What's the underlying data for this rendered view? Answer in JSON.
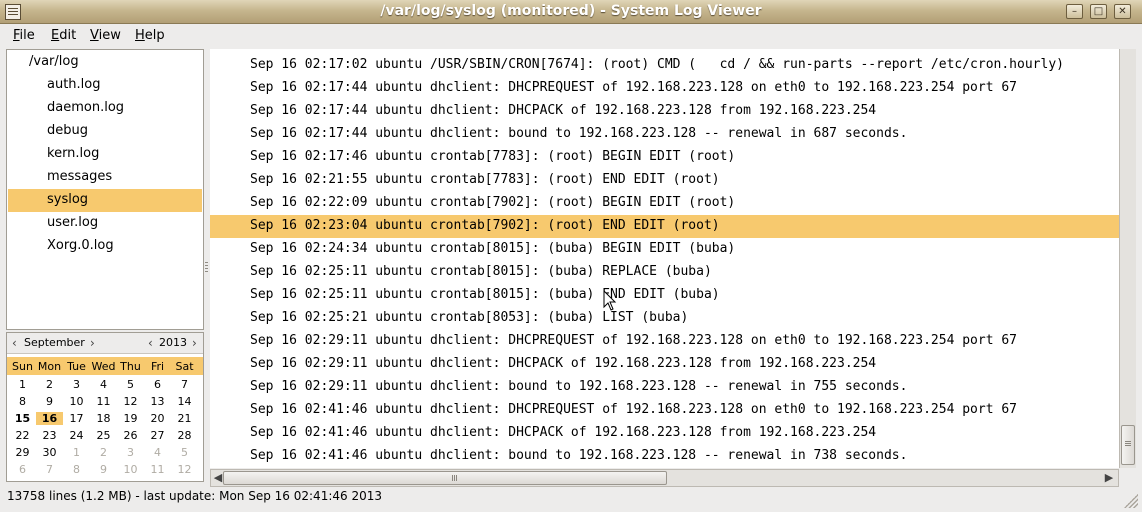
{
  "window": {
    "title": "/var/log/syslog (monitored) - System Log Viewer",
    "buttons": {
      "minimize": "–",
      "maximize": "□",
      "close": "✕"
    }
  },
  "menu": [
    {
      "label": "File",
      "mnemonic": "F",
      "rest": "ile"
    },
    {
      "label": "Edit",
      "mnemonic": "E",
      "rest": "dit"
    },
    {
      "label": "View",
      "mnemonic": "V",
      "rest": "iew"
    },
    {
      "label": "Help",
      "mnemonic": "H",
      "rest": "elp"
    }
  ],
  "sidebar": {
    "root": "/var/log",
    "items": [
      {
        "label": "auth.log"
      },
      {
        "label": "daemon.log"
      },
      {
        "label": "debug"
      },
      {
        "label": "kern.log"
      },
      {
        "label": "messages"
      },
      {
        "label": "syslog",
        "selected": true
      },
      {
        "label": "user.log"
      },
      {
        "label": "Xorg.0.log"
      }
    ]
  },
  "calendar": {
    "month": "September",
    "year": "2013",
    "day_names": [
      "Sun",
      "Mon",
      "Tue",
      "Wed",
      "Thu",
      "Fri",
      "Sat"
    ],
    "weeks": [
      [
        "1",
        "2",
        "3",
        "4",
        "5",
        "6",
        "7"
      ],
      [
        "8",
        "9",
        "10",
        "11",
        "12",
        "13",
        "14"
      ],
      [
        "15",
        "16",
        "17",
        "18",
        "19",
        "20",
        "21"
      ],
      [
        "22",
        "23",
        "24",
        "25",
        "26",
        "27",
        "28"
      ],
      [
        "29",
        "30",
        "1",
        "2",
        "3",
        "4",
        "5"
      ],
      [
        "6",
        "7",
        "8",
        "9",
        "10",
        "11",
        "12"
      ]
    ],
    "bold_day": "15",
    "selected_day": "16",
    "muted_from_index": 30
  },
  "log": {
    "lines": [
      "Sep 16 02:17:02 ubuntu /USR/SBIN/CRON[7674]: (root) CMD (   cd / && run-parts --report /etc/cron.hourly)",
      "Sep 16 02:17:44 ubuntu dhclient: DHCPREQUEST of 192.168.223.128 on eth0 to 192.168.223.254 port 67",
      "Sep 16 02:17:44 ubuntu dhclient: DHCPACK of 192.168.223.128 from 192.168.223.254",
      "Sep 16 02:17:44 ubuntu dhclient: bound to 192.168.223.128 -- renewal in 687 seconds.",
      "Sep 16 02:17:46 ubuntu crontab[7783]: (root) BEGIN EDIT (root)",
      "Sep 16 02:21:55 ubuntu crontab[7783]: (root) END EDIT (root)",
      "Sep 16 02:22:09 ubuntu crontab[7902]: (root) BEGIN EDIT (root)",
      "Sep 16 02:23:04 ubuntu crontab[7902]: (root) END EDIT (root)",
      "Sep 16 02:24:34 ubuntu crontab[8015]: (buba) BEGIN EDIT (buba)",
      "Sep 16 02:25:11 ubuntu crontab[8015]: (buba) REPLACE (buba)",
      "Sep 16 02:25:11 ubuntu crontab[8015]: (buba) END EDIT (buba)",
      "Sep 16 02:25:21 ubuntu crontab[8053]: (buba) LIST (buba)",
      "Sep 16 02:29:11 ubuntu dhclient: DHCPREQUEST of 192.168.223.128 on eth0 to 192.168.223.254 port 67",
      "Sep 16 02:29:11 ubuntu dhclient: DHCPACK of 192.168.223.128 from 192.168.223.254",
      "Sep 16 02:29:11 ubuntu dhclient: bound to 192.168.223.128 -- renewal in 755 seconds.",
      "Sep 16 02:41:46 ubuntu dhclient: DHCPREQUEST of 192.168.223.128 on eth0 to 192.168.223.254 port 67",
      "Sep 16 02:41:46 ubuntu dhclient: DHCPACK of 192.168.223.128 from 192.168.223.254",
      "Sep 16 02:41:46 ubuntu dhclient: bound to 192.168.223.128 -- renewal in 738 seconds."
    ],
    "highlighted_index": 7
  },
  "status": {
    "text": "13758 lines (1.2 MB) - last update: Mon Sep 16 02:41:46 2013"
  },
  "colors": {
    "selection": "#f7c96e",
    "window_bg": "#edeceb"
  }
}
